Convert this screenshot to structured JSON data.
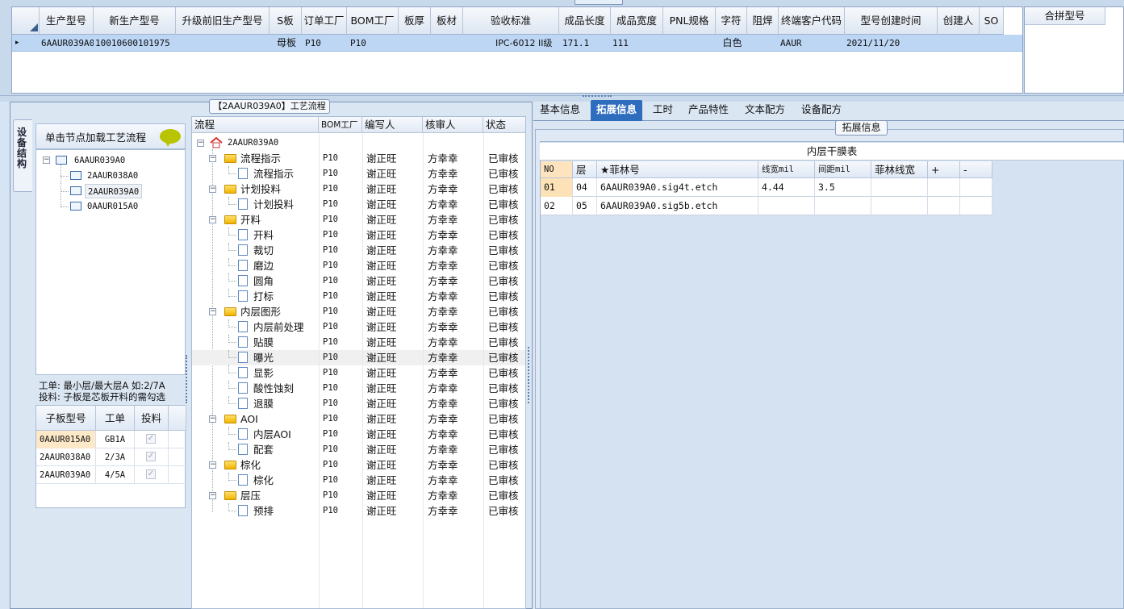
{
  "top_grid": {
    "columns": [
      "生产型号",
      "新生产型号",
      "升级前旧生产型号",
      "S板",
      "订单工厂",
      "BOM工厂",
      "板厚",
      "板材",
      "验收标准",
      "成品长度",
      "成品宽度",
      "PNL规格",
      "字符",
      "阻焊",
      "终端客户代码",
      "型号创建时间",
      "创建人",
      "SO"
    ],
    "row": {
      "marker": "▸",
      "生产型号": "6AAUR039A0",
      "新生产型号": "10010600101975",
      "升级前旧生产型号": "",
      "S板": "母板",
      "订单工厂": "P10",
      "BOM工厂": "P10",
      "板厚": "",
      "板材": "",
      "验收标准": "IPC-6012 II级",
      "成品长度": "171.1",
      "成品宽度": "111",
      "PNL规格": "",
      "字符": "白色",
      "阻焊": "",
      "终端客户代码": "AAUR",
      "型号创建时间": "2021/11/20",
      "创建人": "",
      "SO": ""
    },
    "merge_header": "合拼型号"
  },
  "left": {
    "panel_title": "【2AAUR039A0】工艺流程",
    "side_tab": "设备结构",
    "node_hint": "单击节点加载工艺流程",
    "struct_tree": [
      {
        "label": "6AAUR039A0",
        "level": 0
      },
      {
        "label": "2AAUR038A0",
        "level": 1
      },
      {
        "label": "2AAUR039A0",
        "level": 1,
        "selected": true
      },
      {
        "label": "0AAUR015A0",
        "level": 1
      }
    ],
    "note1": "工单: 最小层/最大层A 如:2/7A",
    "note2": "投料: 子板是芯板开料的需勾选",
    "sub_grid": {
      "headers": [
        "子板型号",
        "工单",
        "投料"
      ],
      "rows": [
        {
          "model": "0AAUR015A0",
          "order": "GB1A",
          "check": "✓"
        },
        {
          "model": "2AAUR038A0",
          "order": "2/3A",
          "check": "✓"
        },
        {
          "model": "2AAUR039A0",
          "order": "4/5A",
          "check": "✓"
        }
      ]
    }
  },
  "process": {
    "headers": [
      "流程",
      "BOM工厂",
      "编写人",
      "核审人",
      "状态"
    ],
    "root": "2AAUR039A0",
    "rows": [
      {
        "name": "流程指示",
        "level": 1,
        "folder": true,
        "bom": "P10",
        "writer": "谢正旺",
        "reviewer": "方幸幸",
        "status": "已审核"
      },
      {
        "name": "流程指示",
        "level": 2,
        "folder": false,
        "bom": "P10",
        "writer": "谢正旺",
        "reviewer": "方幸幸",
        "status": "已审核"
      },
      {
        "name": "计划投料",
        "level": 1,
        "folder": true,
        "bom": "P10",
        "writer": "谢正旺",
        "reviewer": "方幸幸",
        "status": "已审核"
      },
      {
        "name": "计划投料",
        "level": 2,
        "folder": false,
        "bom": "P10",
        "writer": "谢正旺",
        "reviewer": "方幸幸",
        "status": "已审核"
      },
      {
        "name": "开料",
        "level": 1,
        "folder": true,
        "bom": "P10",
        "writer": "谢正旺",
        "reviewer": "方幸幸",
        "status": "已审核"
      },
      {
        "name": "开料",
        "level": 2,
        "folder": false,
        "bom": "P10",
        "writer": "谢正旺",
        "reviewer": "方幸幸",
        "status": "已审核"
      },
      {
        "name": "裁切",
        "level": 2,
        "folder": false,
        "bom": "P10",
        "writer": "谢正旺",
        "reviewer": "方幸幸",
        "status": "已审核"
      },
      {
        "name": "磨边",
        "level": 2,
        "folder": false,
        "bom": "P10",
        "writer": "谢正旺",
        "reviewer": "方幸幸",
        "status": "已审核"
      },
      {
        "name": "圆角",
        "level": 2,
        "folder": false,
        "bom": "P10",
        "writer": "谢正旺",
        "reviewer": "方幸幸",
        "status": "已审核"
      },
      {
        "name": "打标",
        "level": 2,
        "folder": false,
        "bom": "P10",
        "writer": "谢正旺",
        "reviewer": "方幸幸",
        "status": "已审核"
      },
      {
        "name": "内层图形",
        "level": 1,
        "folder": true,
        "bom": "P10",
        "writer": "谢正旺",
        "reviewer": "方幸幸",
        "status": "已审核"
      },
      {
        "name": "内层前处理",
        "level": 2,
        "folder": false,
        "bom": "P10",
        "writer": "谢正旺",
        "reviewer": "方幸幸",
        "status": "已审核"
      },
      {
        "name": "贴膜",
        "level": 2,
        "folder": false,
        "bom": "P10",
        "writer": "谢正旺",
        "reviewer": "方幸幸",
        "status": "已审核"
      },
      {
        "name": "曝光",
        "level": 2,
        "folder": false,
        "bom": "P10",
        "writer": "谢正旺",
        "reviewer": "方幸幸",
        "status": "已审核",
        "selected": true
      },
      {
        "name": "显影",
        "level": 2,
        "folder": false,
        "bom": "P10",
        "writer": "谢正旺",
        "reviewer": "方幸幸",
        "status": "已审核"
      },
      {
        "name": "酸性蚀刻",
        "level": 2,
        "folder": false,
        "bom": "P10",
        "writer": "谢正旺",
        "reviewer": "方幸幸",
        "status": "已审核"
      },
      {
        "name": "退膜",
        "level": 2,
        "folder": false,
        "bom": "P10",
        "writer": "谢正旺",
        "reviewer": "方幸幸",
        "status": "已审核"
      },
      {
        "name": "AOI",
        "level": 1,
        "folder": true,
        "bom": "P10",
        "writer": "谢正旺",
        "reviewer": "方幸幸",
        "status": "已审核"
      },
      {
        "name": "内层AOI",
        "level": 2,
        "folder": false,
        "bom": "P10",
        "writer": "谢正旺",
        "reviewer": "方幸幸",
        "status": "已审核"
      },
      {
        "name": "配套",
        "level": 2,
        "folder": false,
        "bom": "P10",
        "writer": "谢正旺",
        "reviewer": "方幸幸",
        "status": "已审核"
      },
      {
        "name": "棕化",
        "level": 1,
        "folder": true,
        "bom": "P10",
        "writer": "谢正旺",
        "reviewer": "方幸幸",
        "status": "已审核"
      },
      {
        "name": "棕化",
        "level": 2,
        "folder": false,
        "bom": "P10",
        "writer": "谢正旺",
        "reviewer": "方幸幸",
        "status": "已审核"
      },
      {
        "name": "层压",
        "level": 1,
        "folder": true,
        "bom": "P10",
        "writer": "谢正旺",
        "reviewer": "方幸幸",
        "status": "已审核"
      },
      {
        "name": "预排",
        "level": 2,
        "folder": false,
        "bom": "P10",
        "writer": "谢正旺",
        "reviewer": "方幸幸",
        "status": "已审核"
      }
    ]
  },
  "right": {
    "tabs": [
      "基本信息",
      "拓展信息",
      "工时",
      "产品特性",
      "文本配方",
      "设备配方"
    ],
    "active_tab": 1,
    "group_title": "拓展信息",
    "table_title": "内层干膜表",
    "headers": [
      "NO",
      "层",
      "★菲林号",
      "线宽mil",
      "间距mil",
      "菲林线宽",
      "+",
      "-"
    ],
    "rows": [
      {
        "no": "01",
        "layer": "04",
        "film": "6AAUR039A0.sig4t.etch",
        "width": "4.44",
        "space": "3.5",
        "film_width": ""
      },
      {
        "no": "02",
        "layer": "05",
        "film": "6AAUR039A0.sig5b.etch",
        "width": "",
        "space": "",
        "film_width": ""
      }
    ]
  },
  "colors": {
    "accent": "#2e6dbd",
    "selection": "#bcd6f4",
    "folder": "#f2b400",
    "bubble": "#b8c400"
  }
}
